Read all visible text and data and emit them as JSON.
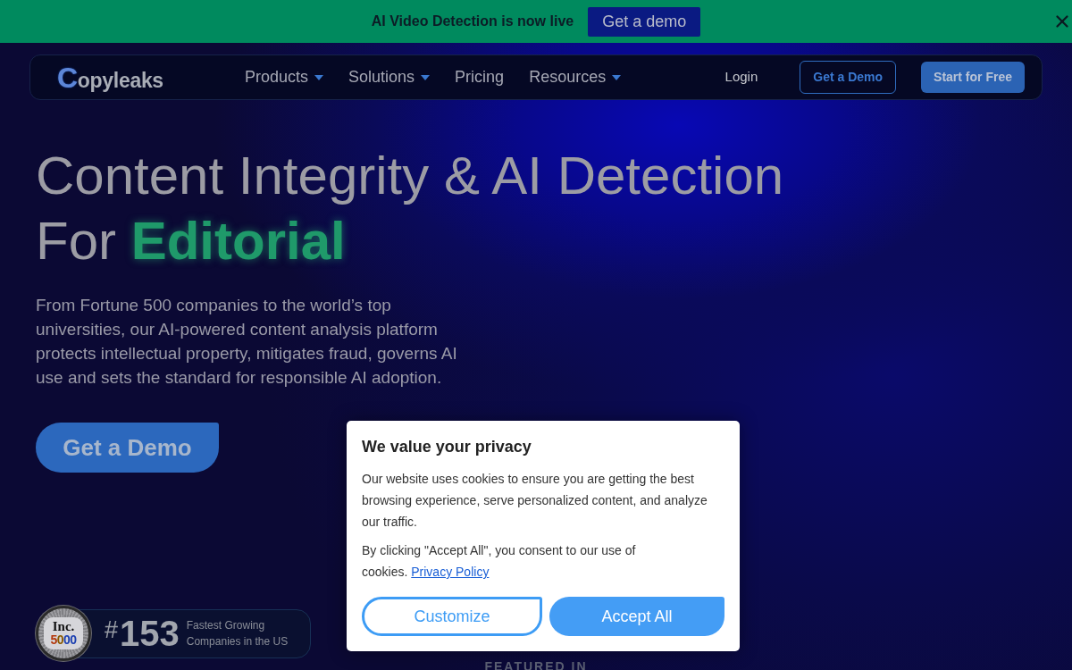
{
  "announcement_bar": {
    "text": "AI Video Detection is now live",
    "button": "Get a demo"
  },
  "navbar": {
    "logo": "Copyleaks",
    "menu": [
      {
        "label": "Products",
        "dropdown": true
      },
      {
        "label": "Solutions",
        "dropdown": true
      },
      {
        "label": "Pricing",
        "dropdown": false
      },
      {
        "label": "Resources",
        "dropdown": true
      }
    ],
    "login": "Login",
    "buttons": [
      {
        "label": "Get a Demo",
        "kind": "outline"
      },
      {
        "label": "Start for Free",
        "kind": "filled"
      }
    ]
  },
  "hero": {
    "title_line_1": "Content Integrity & AI Detection",
    "title_prefix": "For",
    "title_highlight": "Editorial",
    "description": "From Fortune 500 companies to the world’s top universities, our AI-powered content analysis platform protects intellectual property, mitigates fraud, governs AI use and sets the standard for responsible AI adoption.",
    "cta": "Get a Demo"
  },
  "award": {
    "seal_brand": "Inc.",
    "seal_number": "5000",
    "hash": "#",
    "rank": "153",
    "caption": "Fastest Growing Companies in the US"
  },
  "featured_label": "FEATURED IN",
  "cookie_dialog": {
    "title": "We value your privacy",
    "body": "Our website uses cookies to ensure you are getting the best browsing experience, serve personalized content, and analyze our traffic.",
    "consent_text": "By clicking \"Accept All\", you consent to our use of cookies.",
    "link": "Privacy Policy",
    "buttons": [
      {
        "label": "Customize",
        "kind": "outline"
      },
      {
        "label": "Accept All",
        "kind": "filled"
      }
    ]
  }
}
